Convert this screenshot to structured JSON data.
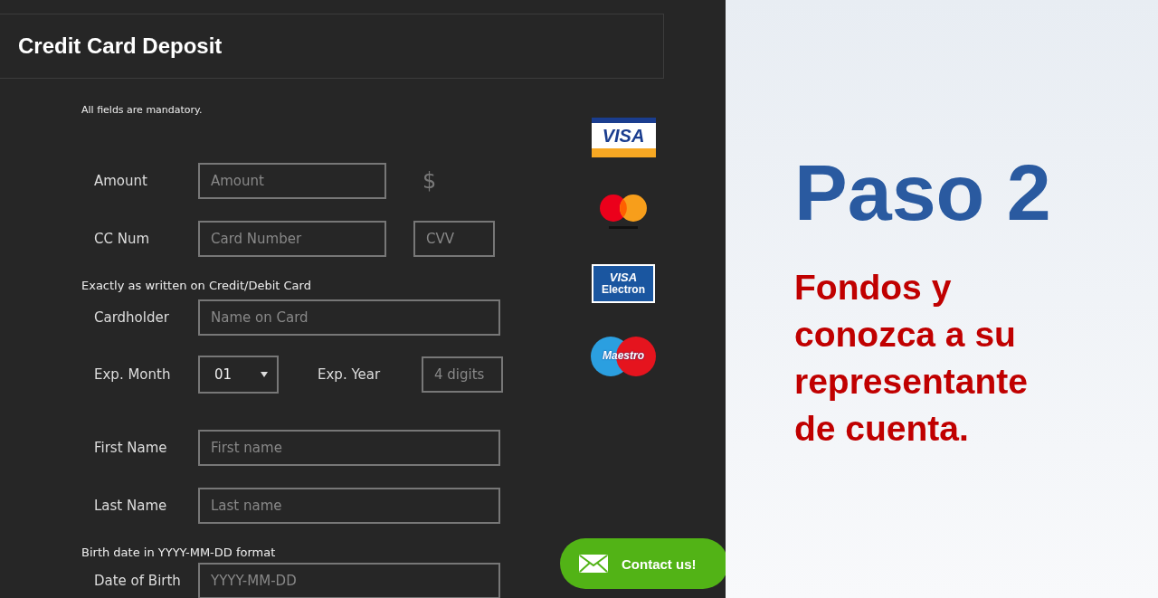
{
  "deposit": {
    "title": "Credit Card Deposit",
    "note": "All fields are mandatory.",
    "rows": [
      {
        "kind": "fields",
        "items": [
          {
            "kind": "label",
            "text": "Amount"
          },
          {
            "kind": "input",
            "placeholder": "Amount"
          },
          {
            "kind": "currency",
            "text": "$"
          }
        ]
      },
      {
        "kind": "fields",
        "items": [
          {
            "kind": "label",
            "text": "CC Num"
          },
          {
            "kind": "input",
            "placeholder": "Card Number"
          },
          {
            "kind": "short-input",
            "placeholder": "CVV"
          }
        ]
      },
      {
        "kind": "note",
        "text": "Exactly as written on Credit/Debit Card"
      },
      {
        "kind": "fields",
        "items": [
          {
            "kind": "label",
            "text": "Cardholder"
          },
          {
            "kind": "wide-input",
            "placeholder": "Name on Card"
          }
        ]
      },
      {
        "kind": "fields",
        "items": [
          {
            "kind": "label",
            "text": "Exp. Month"
          },
          {
            "kind": "select",
            "value": "01"
          },
          {
            "kind": "inline-label",
            "text": "Exp. Year"
          },
          {
            "kind": "short-input",
            "placeholder": "4 digits"
          }
        ]
      },
      {
        "kind": "fields",
        "items": [
          {
            "kind": "label",
            "text": "First Name"
          },
          {
            "kind": "wide-input",
            "placeholder": "First name"
          }
        ]
      },
      {
        "kind": "fields",
        "items": [
          {
            "kind": "label",
            "text": "Last Name"
          },
          {
            "kind": "wide-input",
            "placeholder": "Last name"
          }
        ]
      },
      {
        "kind": "note",
        "text": "Birth date in YYYY-MM-DD format"
      },
      {
        "kind": "fields",
        "items": [
          {
            "kind": "label",
            "text": "Date of Birth"
          },
          {
            "kind": "wide-input",
            "placeholder": "YYYY-MM-DD"
          }
        ]
      }
    ],
    "logos": [
      {
        "kind": "visa",
        "text": "VISA"
      },
      {
        "kind": "mastercard"
      },
      {
        "kind": "visa-electron",
        "text": "VISA",
        "subtext": "Electron"
      },
      {
        "kind": "maestro",
        "text": "Maestro"
      }
    ],
    "contact": {
      "label": "Contact us!"
    }
  },
  "slide": {
    "heading": "Paso 2",
    "body": "Fondos y conozca a su representante de cuenta."
  }
}
